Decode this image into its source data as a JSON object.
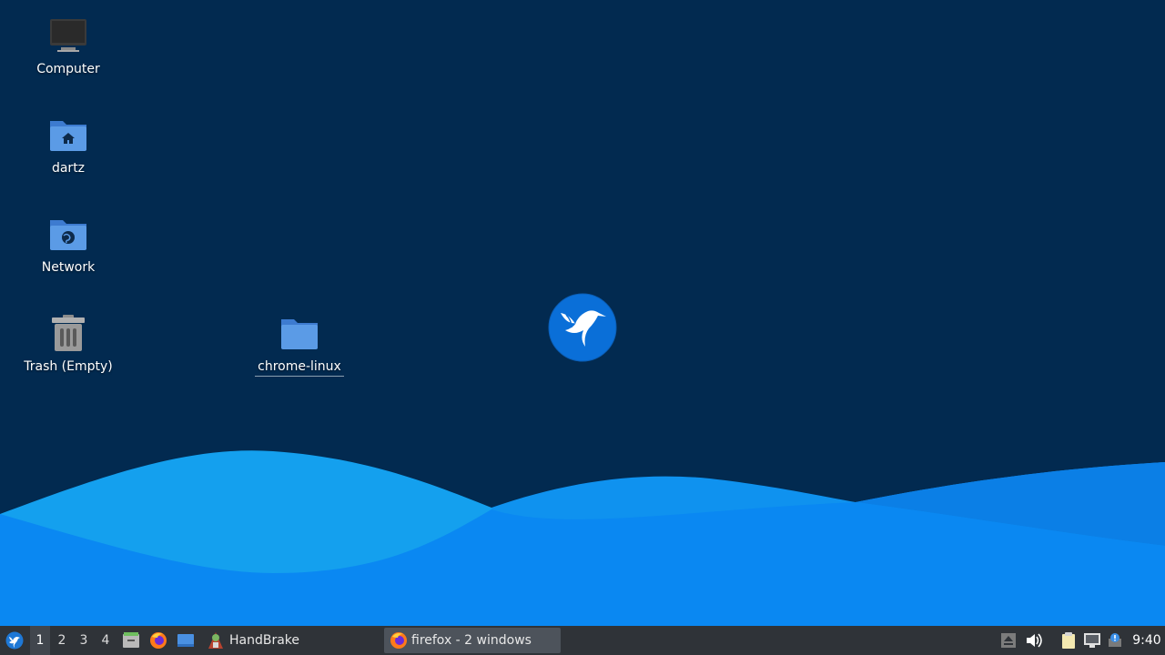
{
  "desktop": {
    "icons": [
      {
        "label": "Computer",
        "icon": "computer-icon"
      },
      {
        "label": "dartz",
        "icon": "home-folder-icon"
      },
      {
        "label": "Network",
        "icon": "network-folder-icon"
      },
      {
        "label": "Trash (Empty)",
        "icon": "trash-icon"
      },
      {
        "label": "chrome-linux",
        "icon": "folder-icon",
        "selected": true
      }
    ],
    "logo": "hummingbird-logo-icon"
  },
  "taskbar": {
    "menu_icon": "start-menu-icon",
    "workspaces": [
      "1",
      "2",
      "3",
      "4"
    ],
    "active_workspace": "1",
    "launchers": [
      "file-manager-icon",
      "firefox-icon",
      "show-desktop-icon"
    ],
    "tasks": [
      {
        "label": "HandBrake",
        "icon": "handbrake-icon"
      },
      {
        "label": "firefox - 2 windows",
        "icon": "firefox-icon",
        "active": true
      }
    ],
    "tray": [
      "eject-icon",
      "volume-icon",
      "clipboard-icon",
      "network-wired-icon",
      "update-notifier-icon"
    ],
    "clock": "9:40"
  },
  "colors": {
    "background": "#022a50",
    "wave_light": "#1aa6f0",
    "wave_mid": "#0a84f0",
    "panel": "#2f3338",
    "folder": "#4a90e2"
  }
}
